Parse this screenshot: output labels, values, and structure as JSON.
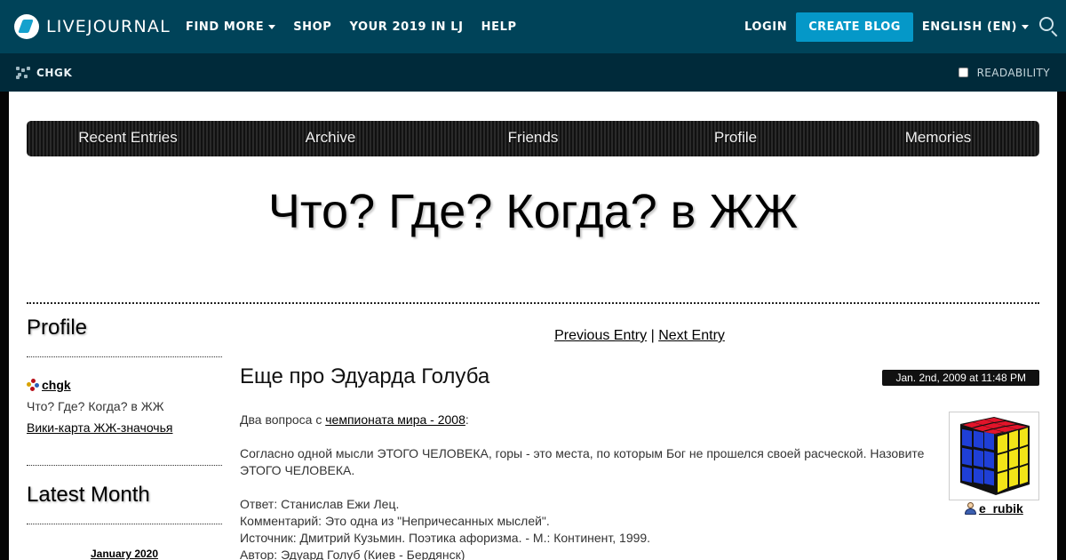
{
  "lj_header": {
    "logo_text": "LIVEJOURNAL",
    "nav": [
      {
        "label": "FIND MORE",
        "dropdown": true
      },
      {
        "label": "SHOP",
        "dropdown": false
      },
      {
        "label": "YOUR 2019 IN LJ",
        "dropdown": false
      },
      {
        "label": "HELP",
        "dropdown": false
      }
    ],
    "login_label": "LOGIN",
    "create_blog_label": "CREATE BLOG",
    "language_label": "ENGLISH (EN)"
  },
  "sub_bar": {
    "journal_user": "CHGK",
    "readability_label": "READABILITY",
    "readability_checked": false
  },
  "journal": {
    "nav": [
      "Recent Entries",
      "Archive",
      "Friends",
      "Profile",
      "Memories"
    ],
    "title": "Что? Где? Когда? в ЖЖ"
  },
  "sidebar": {
    "profile_heading": "Profile",
    "username": "chgk",
    "description": "Что? Где? Когда? в ЖЖ",
    "link": "Вики-карта ЖЖ-значочья",
    "latest_heading": "Latest Month",
    "month": "January 2020"
  },
  "entry": {
    "prev_label": "Previous Entry",
    "separator": "|",
    "next_label": "Next Entry",
    "title": "Еще про Эдуарда Голуба",
    "date": "Jan. 2nd, 2009 at 11:48 PM",
    "intro_prefix": "Два вопроса с ",
    "intro_link": "чемпионата мира - 2008",
    "intro_suffix": ":",
    "question": "Согласно одной мысли ЭТОГО ЧЕЛОВЕКА, горы - это места, по которым Бог не прошелся своей расческой. Назовите ЭТОГО ЧЕЛОВЕКА.",
    "answer": "Ответ: Станислав Ежи Лец.",
    "comment": "Комментарий: Это одна из \"Непричесанных мыслей\".",
    "source": "Источник: Дмитрий Кузьмин. Поэтика афоризма. - М.: Континент, 1999.",
    "author": "Автор: Эдуард Голуб (Киев - Бердянск)",
    "poster": "e_rubik"
  },
  "colors": {
    "lj_top": "#004359",
    "lj_sub": "#002a3a",
    "create_button": "#0598c8",
    "frame": "#050505"
  }
}
